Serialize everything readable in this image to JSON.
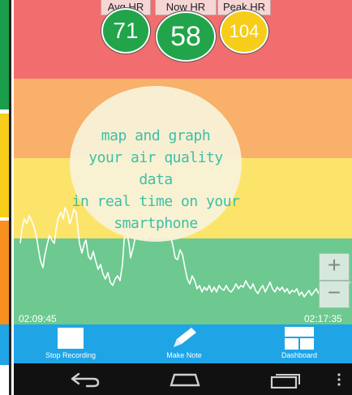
{
  "stats": {
    "avg": {
      "label": "Avg HR",
      "value": "71"
    },
    "now": {
      "label": "Now HR",
      "value": "58"
    },
    "peak": {
      "label": "Peak HR",
      "value": "104"
    }
  },
  "promo": {
    "lines": [
      "map and graph",
      "your air quality data",
      "in real time on your",
      "smartphone"
    ]
  },
  "graph": {
    "start_time": "02:09:45",
    "end_time": "02:17:35",
    "line_color": "#ffffff",
    "zone_colors": {
      "red": "#f26d6d",
      "orange": "#f9b06a",
      "yellow": "#fce46a",
      "green": "#6dc98f"
    }
  },
  "zoom": {
    "in_label": "+",
    "out_label": "−"
  },
  "toolbar": {
    "stop_label": "Stop Recording",
    "note_label": "Make Note",
    "dashboard_label": "Dashboard",
    "background": "#1fa4e6"
  },
  "icons": {
    "stop": "stop-square-icon",
    "note": "pencil-icon",
    "dashboard": "dashboard-grid-icon",
    "back": "back-icon",
    "home": "home-icon",
    "recents": "recents-icon",
    "menu": "overflow-menu-icon"
  }
}
